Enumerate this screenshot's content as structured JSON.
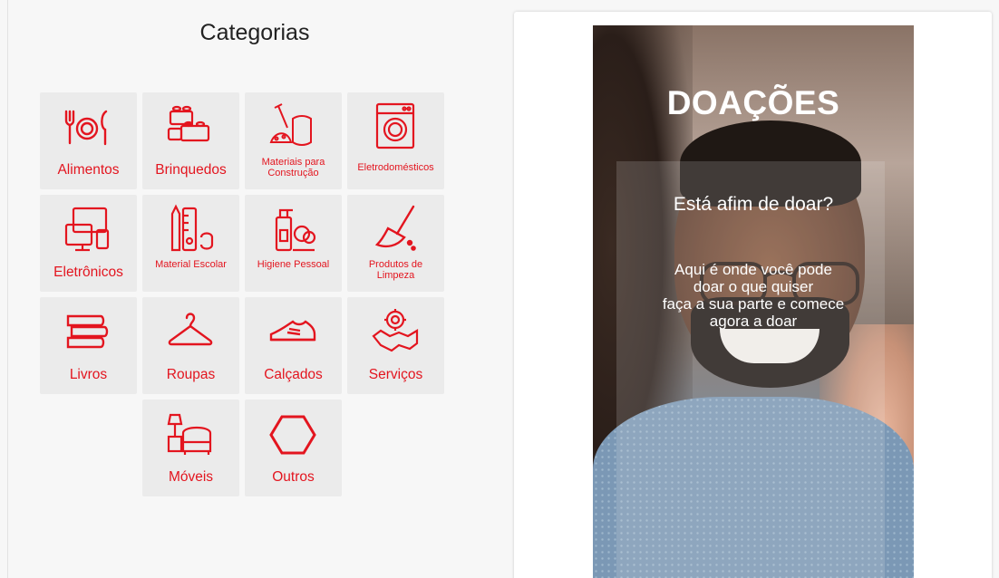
{
  "categories": {
    "title": "Categorias",
    "items": [
      {
        "label": "Alimentos",
        "icon": "cutlery-plate-icon"
      },
      {
        "label": "Brinquedos",
        "icon": "toy-blocks-icon"
      },
      {
        "label": "Materiais para Construção",
        "icon": "construction-tools-icon"
      },
      {
        "label": "Eletrodomésticos",
        "icon": "washing-machine-icon"
      },
      {
        "label": "Eletrônicos",
        "icon": "devices-icon"
      },
      {
        "label": "Material Escolar",
        "icon": "school-supplies-icon"
      },
      {
        "label": "Higiene Pessoal",
        "icon": "hygiene-products-icon"
      },
      {
        "label": "Produtos de Limpeza",
        "icon": "broom-icon"
      },
      {
        "label": "Livros",
        "icon": "books-icon"
      },
      {
        "label": "Roupas",
        "icon": "hanger-icon"
      },
      {
        "label": "Calçados",
        "icon": "sneaker-icon"
      },
      {
        "label": "Serviços",
        "icon": "handshake-gear-icon"
      },
      {
        "label": "Móveis",
        "icon": "furniture-icon"
      },
      {
        "label": "Outros",
        "icon": "hexagon-icon"
      }
    ]
  },
  "banner": {
    "heading": "DOAÇÕES",
    "question": "Está afim de doar?",
    "desc_line1": "Aqui é onde você pode",
    "desc_line2": "doar o que quiser",
    "desc_line3": "faça a sua parte e comece",
    "desc_line4": "agora a doar"
  },
  "colors": {
    "accent": "#e3151f",
    "tile_bg": "#ebebeb"
  }
}
